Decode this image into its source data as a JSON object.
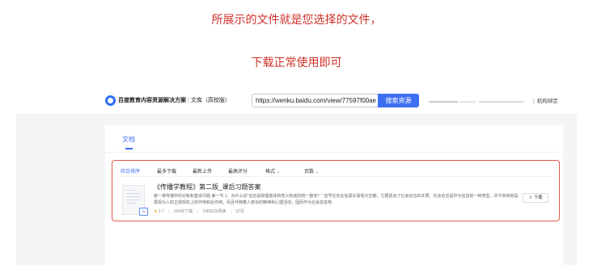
{
  "notice": {
    "line1": "所展示的文件就是您选择的文件，",
    "line2": "下载正常使用即可"
  },
  "header": {
    "brand": "百度教育内容资源解决方案",
    "divider": "|",
    "subtitle": "文库（高校版）",
    "url_value": "https://wenku.baidu.com/view/77597f00ae",
    "search_label": "搜索资源",
    "org_bind": "机构绑定"
  },
  "tabs": {
    "active": "文档"
  },
  "sort_options": [
    {
      "label": "综合排序",
      "active": true
    },
    {
      "label": "最多下载",
      "active": false
    },
    {
      "label": "最新上传",
      "active": false
    },
    {
      "label": "最高评分",
      "active": false
    },
    {
      "label": "格式",
      "active": false,
      "dropdown": true
    },
    {
      "label": "页数",
      "active": false,
      "dropdown": true
    }
  ],
  "result": {
    "title": "《传播学教程》第二版_课后习题答案",
    "snippet": "第一章传播学的对象和基本问题 第一节 1、为什么说\"信息是物理载体和意义构成的统一整体？\" 信号论先在信源论事情元空期，它概括出了社会信息的本质。社会信息是作为信息的一种类型，并不单纯地是再现为人的主观现实上的作用和反作用，而且伴随着人复杂的精神和心理活动，因而作为社会信息物",
    "rating": "2.7",
    "downloads": "164次下载",
    "views": "19650次阅读",
    "pages": "37页",
    "download_label": "下载",
    "badge": "W"
  },
  "colors": {
    "notice_text": "#d0302a",
    "accent": "#3d6ff2",
    "highlight_border": "#e45a4e"
  }
}
